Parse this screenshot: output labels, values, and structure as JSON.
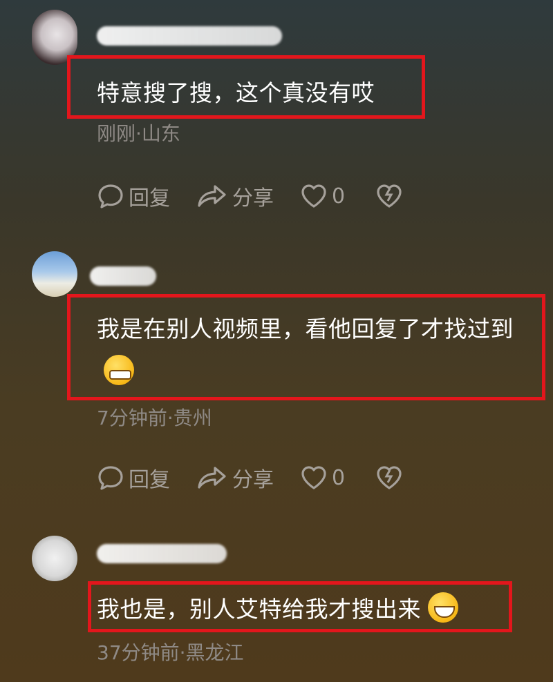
{
  "comments": [
    {
      "text": "特意搜了搜，这个真没有哎",
      "meta": "刚刚·山东",
      "actions": {
        "reply": "回复",
        "share": "分享",
        "likes": "0"
      }
    },
    {
      "text": "我是在别人视频里，看他回复了才找过到",
      "emoji": "grinning-sweat-emoji",
      "meta": "7分钟前·贵州",
      "actions": {
        "reply": "回复",
        "share": "分享",
        "likes": "0"
      }
    },
    {
      "text": "我也是，别人艾特给我才搜出来",
      "emoji": "rolling-laughing-emoji",
      "meta": "37分钟前·黑龙江"
    }
  ],
  "colors": {
    "highlight": "#e3161c",
    "meta_text": "#8f8a86",
    "action_text": "#a6a19b"
  }
}
